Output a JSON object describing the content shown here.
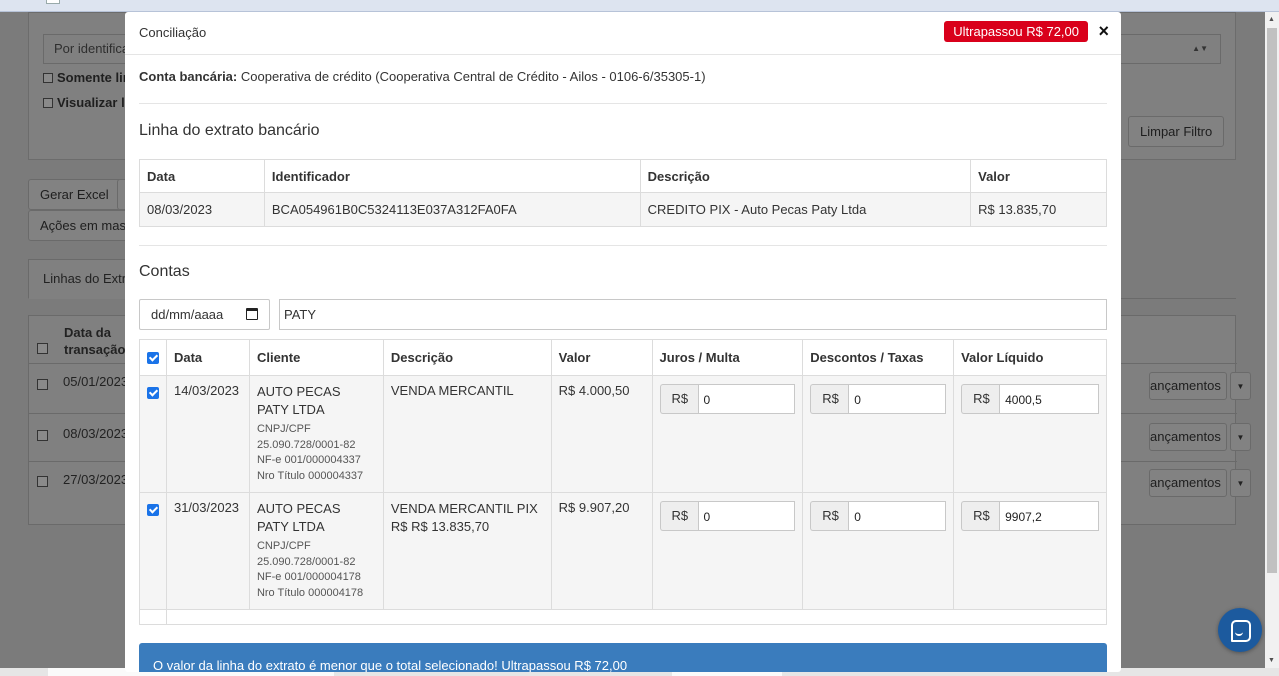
{
  "background": {
    "search_type": "Por identifica",
    "checkbox_1": "Somente lin",
    "checkbox_2": "Visualizar li",
    "clear_filter": "Limpar Filtro",
    "export_excel": "Gerar Excel",
    "bulk_actions": "Ações em mass",
    "tab_label": "Linhas do Extra",
    "table_header": "Data da transação",
    "rows": [
      {
        "date": "05/01/2023",
        "action": "ançamentos"
      },
      {
        "date": "08/03/2023",
        "action": "ançamentos"
      },
      {
        "date": "27/03/2023",
        "action": "ançamentos"
      }
    ]
  },
  "modal": {
    "title": "Conciliação",
    "over_badge": "Ultrapassou R$ 72,00",
    "account_label": "Conta bancária:",
    "account_value": "Cooperativa de crédito (Cooperativa Central de Crédito - Ailos - 0106-6/35305-1)",
    "statement_heading": "Linha do extrato bancário",
    "statement": {
      "headers": [
        "Data",
        "Identificador",
        "Descrição",
        "Valor"
      ],
      "row": {
        "date": "08/03/2023",
        "identifier": "BCA054961B0C5324113E037A312FA0FA",
        "description": "CREDITO PIX - Auto Pecas Paty Ltda",
        "value": "R$ 13.835,70"
      }
    },
    "accounts_heading": "Contas",
    "filter": {
      "date_placeholder": "dd/mm/aaaa",
      "search_value": "PATY"
    },
    "accounts": {
      "headers": [
        "Data",
        "Cliente",
        "Descrição",
        "Valor",
        "Juros / Multa",
        "Descontos / Taxas",
        "Valor Líquido"
      ],
      "currency": "R$",
      "rows": [
        {
          "date": "14/03/2023",
          "client_name": "AUTO PECAS PATY LTDA",
          "doc_label": "CNPJ/CPF",
          "doc": "25.090.728/0001-82",
          "nfe": "NF-e 001/000004337",
          "title": "Nro Título 000004337",
          "description": "VENDA MERCANTIL",
          "value": "R$ 4.000,50",
          "interest": "0",
          "discount": "0",
          "net": "4000,5"
        },
        {
          "date": "31/03/2023",
          "client_name": "AUTO PECAS PATY LTDA",
          "doc_label": "CNPJ/CPF",
          "doc": "25.090.728/0001-82",
          "nfe": "NF-e 001/000004178",
          "title": "Nro Título 000004178",
          "description": "VENDA MERCANTIL PIX R$ R$ 13.835,70",
          "value": "R$ 9.907,20",
          "interest": "0",
          "discount": "0",
          "net": "9907,2"
        }
      ]
    },
    "alert": "O valor da linha do extrato é menor que o total selecionado! Ultrapassou R$ 72,00"
  },
  "colors": {
    "danger": "#d9001b",
    "info": "#3a7cbd",
    "checkbox": "#1a73e8"
  }
}
